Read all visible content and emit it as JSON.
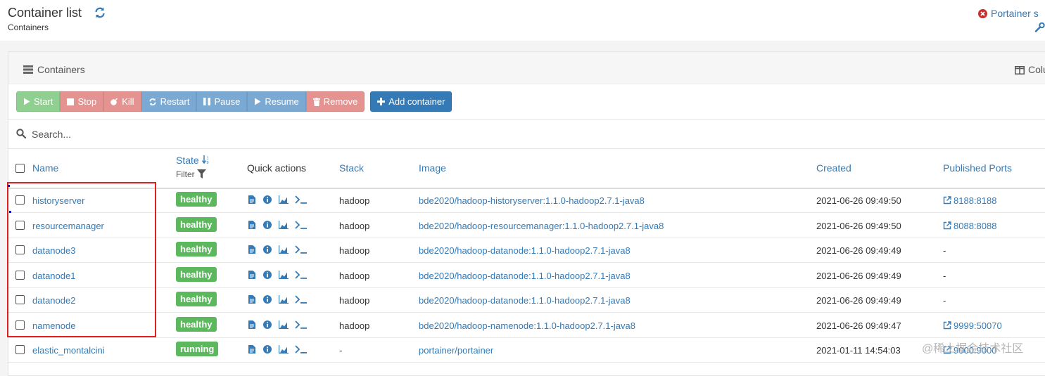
{
  "header": {
    "title": "Container list",
    "breadcrumb": "Containers",
    "right_link": "Portainer s"
  },
  "widget": {
    "title": "Containers",
    "columns_label": "Colu"
  },
  "actions": {
    "start": "Start",
    "stop": "Stop",
    "kill": "Kill",
    "restart": "Restart",
    "pause": "Pause",
    "resume": "Resume",
    "remove": "Remove",
    "add": "Add container"
  },
  "search": {
    "placeholder": "Search..."
  },
  "columns": {
    "name": "Name",
    "state": "State",
    "filter": "Filter",
    "quick_actions": "Quick actions",
    "stack": "Stack",
    "image": "Image",
    "created": "Created",
    "ports": "Published Ports"
  },
  "rows": [
    {
      "name": "historyserver",
      "state": "healthy",
      "stack": "hadoop",
      "image": "bde2020/hadoop-historyserver:1.1.0-hadoop2.7.1-java8",
      "created": "2021-06-26 09:49:50",
      "ports": "8188:8188"
    },
    {
      "name": "resourcemanager",
      "state": "healthy",
      "stack": "hadoop",
      "image": "bde2020/hadoop-resourcemanager:1.1.0-hadoop2.7.1-java8",
      "created": "2021-06-26 09:49:50",
      "ports": "8088:8088"
    },
    {
      "name": "datanode3",
      "state": "healthy",
      "stack": "hadoop",
      "image": "bde2020/hadoop-datanode:1.1.0-hadoop2.7.1-java8",
      "created": "2021-06-26 09:49:49",
      "ports": "-"
    },
    {
      "name": "datanode1",
      "state": "healthy",
      "stack": "hadoop",
      "image": "bde2020/hadoop-datanode:1.1.0-hadoop2.7.1-java8",
      "created": "2021-06-26 09:49:49",
      "ports": "-"
    },
    {
      "name": "datanode2",
      "state": "healthy",
      "stack": "hadoop",
      "image": "bde2020/hadoop-datanode:1.1.0-hadoop2.7.1-java8",
      "created": "2021-06-26 09:49:49",
      "ports": "-"
    },
    {
      "name": "namenode",
      "state": "healthy",
      "stack": "hadoop",
      "image": "bde2020/hadoop-namenode:1.1.0-hadoop2.7.1-java8",
      "created": "2021-06-26 09:49:47",
      "ports": "9999:50070"
    },
    {
      "name": "elastic_montalcini",
      "state": "running",
      "stack": "-",
      "image": "portainer/portainer",
      "created": "2021-01-11 14:54:03",
      "ports": "9000:9000"
    }
  ],
  "watermark": "@稀土掘金技术社区",
  "colors": {
    "link": "#337ab7",
    "badge": "#5cb85c",
    "highlight": "#e02020"
  }
}
